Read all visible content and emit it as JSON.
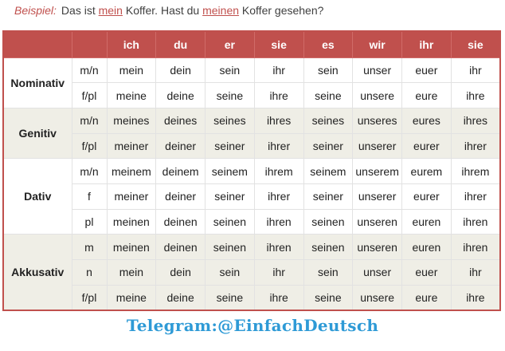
{
  "example": {
    "label": "Beispiel:",
    "part1": "Das ist ",
    "word1": "mein",
    "part2": " Koffer. Hast du ",
    "word2": "meinen",
    "part3": " Koffer gesehen?"
  },
  "header": [
    "ich",
    "du",
    "er",
    "sie",
    "es",
    "wir",
    "ihr",
    "sie"
  ],
  "groups": [
    {
      "case": "Nominativ",
      "rows": [
        {
          "gender": "m/n",
          "cells": [
            "mein",
            "dein",
            "sein",
            "ihr",
            "sein",
            "unser",
            "euer",
            "ihr"
          ]
        },
        {
          "gender": "f/pl",
          "cells": [
            "meine",
            "deine",
            "seine",
            "ihre",
            "seine",
            "unsere",
            "eure",
            "ihre"
          ]
        }
      ]
    },
    {
      "case": "Genitiv",
      "rows": [
        {
          "gender": "m/n",
          "cells": [
            "meines",
            "deines",
            "seines",
            "ihres",
            "seines",
            "unseres",
            "eures",
            "ihres"
          ]
        },
        {
          "gender": "f/pl",
          "cells": [
            "meiner",
            "deiner",
            "seiner",
            "ihrer",
            "seiner",
            "unserer",
            "eurer",
            "ihrer"
          ]
        }
      ]
    },
    {
      "case": "Dativ",
      "rows": [
        {
          "gender": "m/n",
          "cells": [
            "meinem",
            "deinem",
            "seinem",
            "ihrem",
            "seinem",
            "unserem",
            "eurem",
            "ihrem"
          ]
        },
        {
          "gender": "f",
          "cells": [
            "meiner",
            "deiner",
            "seiner",
            "ihrer",
            "seiner",
            "unserer",
            "eurer",
            "ihrer"
          ]
        },
        {
          "gender": "pl",
          "cells": [
            "meinen",
            "deinen",
            "seinen",
            "ihren",
            "seinen",
            "unseren",
            "euren",
            "ihren"
          ]
        }
      ]
    },
    {
      "case": "Akkusativ",
      "rows": [
        {
          "gender": "m",
          "cells": [
            "meinen",
            "deinen",
            "seinen",
            "ihren",
            "seinen",
            "unseren",
            "euren",
            "ihren"
          ]
        },
        {
          "gender": "n",
          "cells": [
            "mein",
            "dein",
            "sein",
            "ihr",
            "sein",
            "unser",
            "euer",
            "ihr"
          ]
        },
        {
          "gender": "f/pl",
          "cells": [
            "meine",
            "deine",
            "seine",
            "ihre",
            "seine",
            "unsere",
            "eure",
            "ihre"
          ]
        }
      ]
    }
  ],
  "footer": "Telegram:@EinfachDeutsch",
  "colors": {
    "accent": "#c0504d",
    "shade": "#efeee6",
    "footer": "#2e9ad6"
  }
}
